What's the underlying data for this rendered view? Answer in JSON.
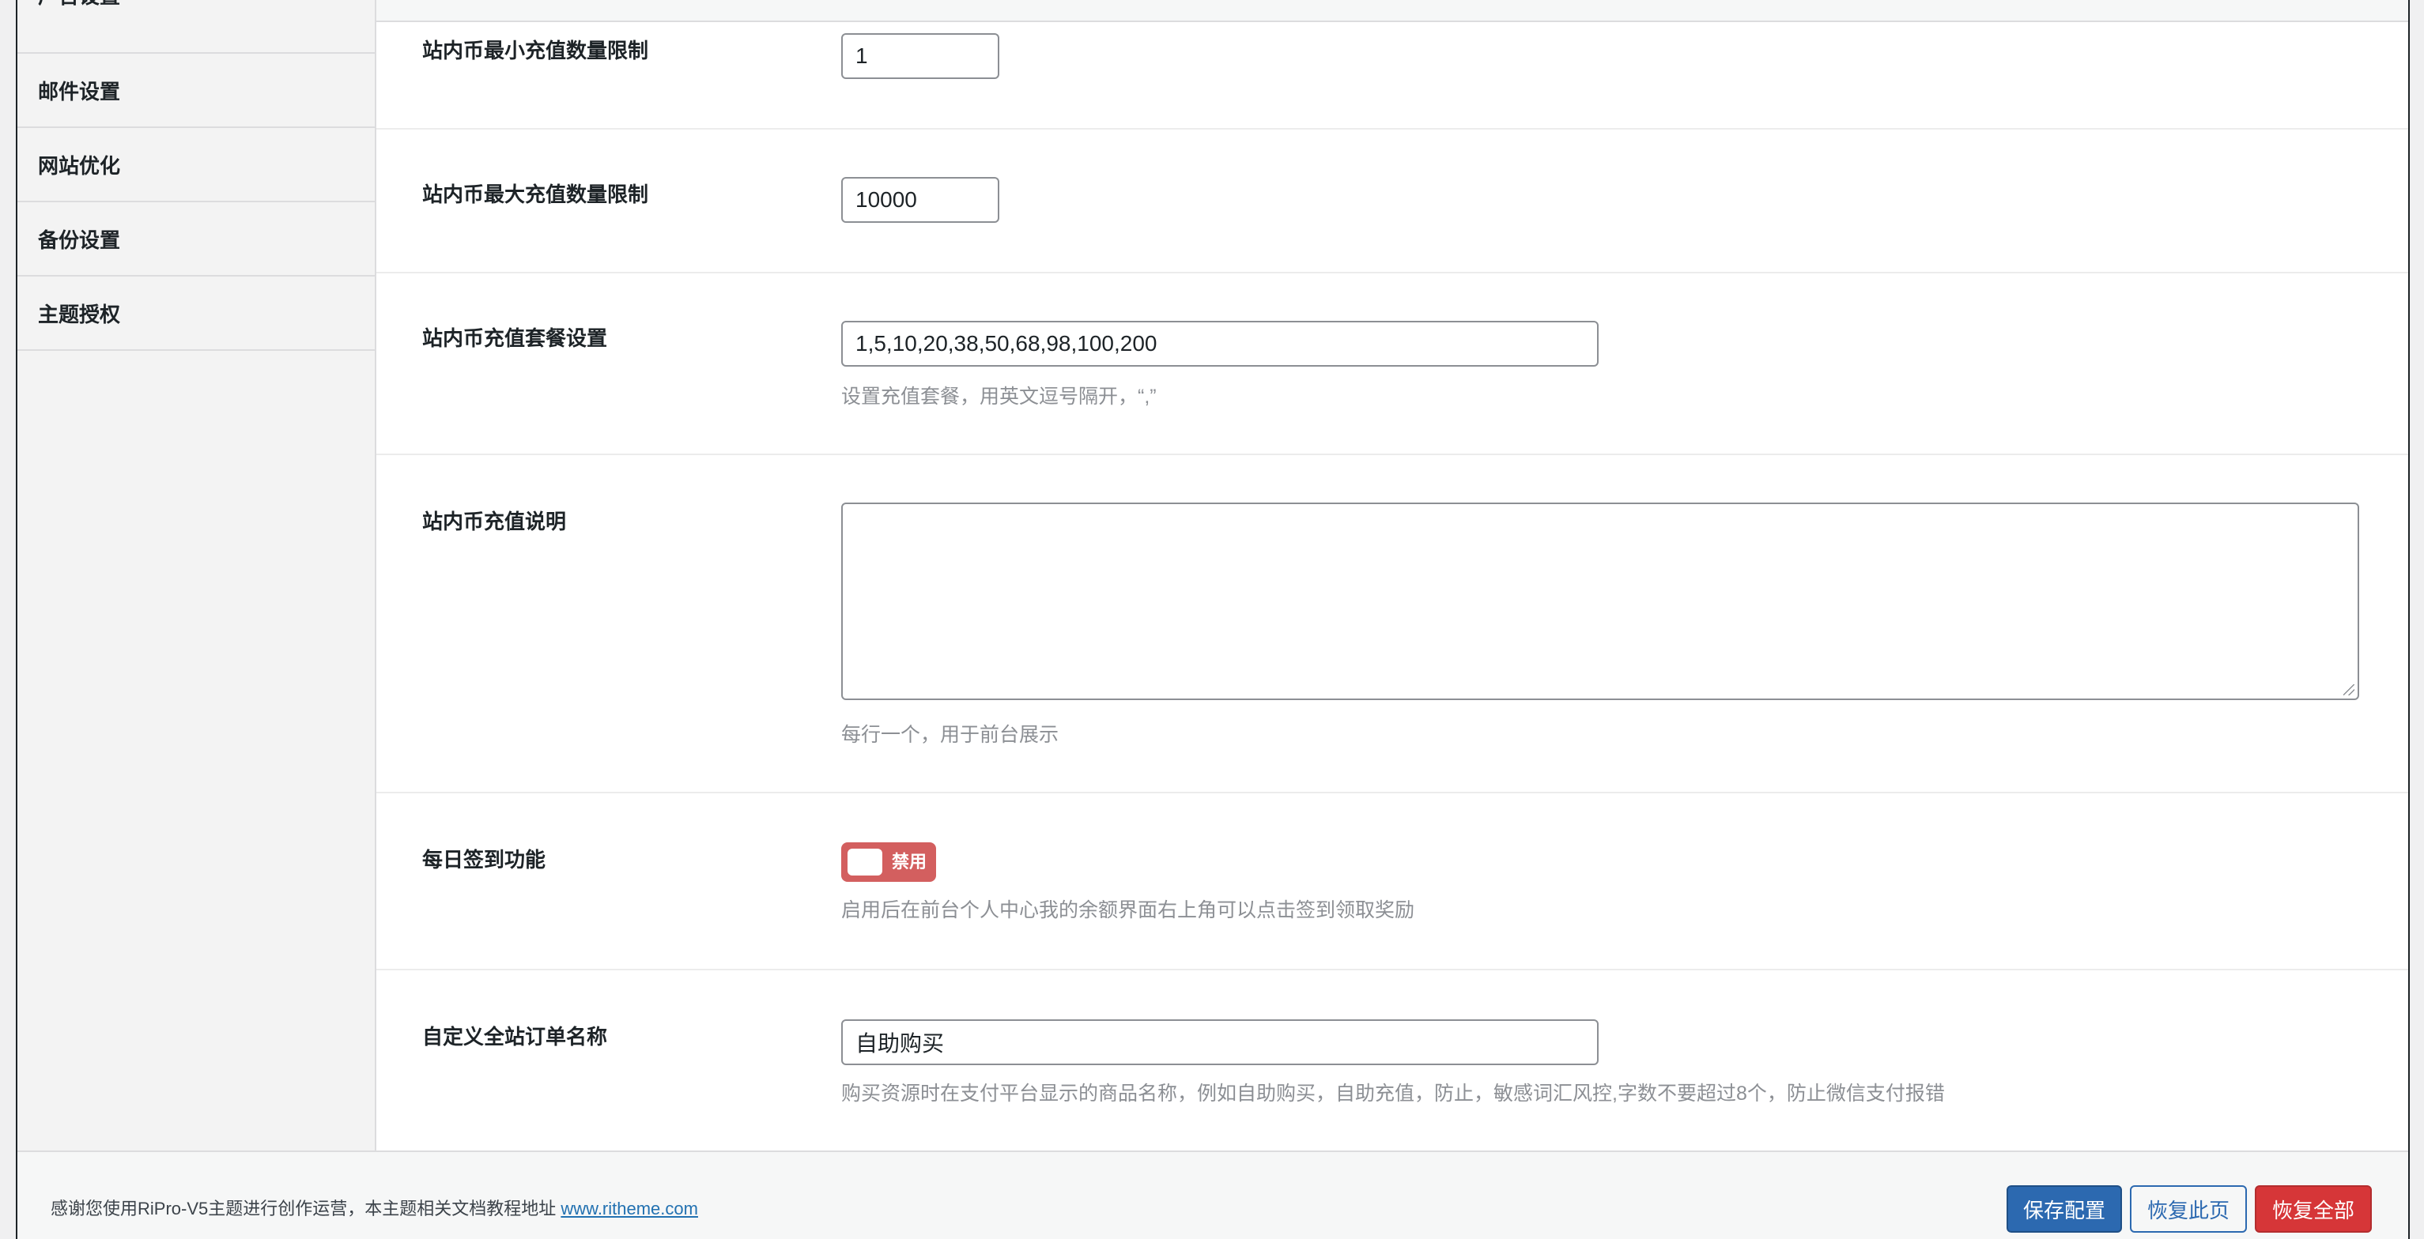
{
  "sidebar": {
    "items": [
      {
        "label": "广告设置"
      },
      {
        "label": "邮件设置"
      },
      {
        "label": "网站优化"
      },
      {
        "label": "备份设置"
      },
      {
        "label": "主题授权"
      }
    ]
  },
  "fields": {
    "min_recharge": {
      "label": "站内币最小充值数量限制",
      "value": "1"
    },
    "max_recharge": {
      "label": "站内币最大充值数量限制",
      "value": "10000"
    },
    "packages": {
      "label": "站内币充值套餐设置",
      "value": "1,5,10,20,38,50,68,98,100,200",
      "help": "设置充值套餐，用英文逗号隔开，“,”"
    },
    "description": {
      "label": "站内币充值说明",
      "value": "",
      "help": "每行一个，用于前台展示"
    },
    "daily_checkin": {
      "label": "每日签到功能",
      "toggle_text": "禁用",
      "enabled": false,
      "help": "启用后在前台个人中心我的余额界面右上角可以点击签到领取奖励"
    },
    "order_name": {
      "label": "自定义全站订单名称",
      "value": "自助购买",
      "help": "购买资源时在支付平台显示的商品名称，例如自助购买，自助充值，防止，敏感词汇风控,字数不要超过8个，防止微信支付报错"
    }
  },
  "footer": {
    "text": "感谢您使用RiPro-V5主题进行创作运营，本主题相关文档教程地址",
    "link_text": "www.ritheme.com",
    "buttons": {
      "save": "保存配置",
      "reset_page": "恢复此页",
      "reset_all": "恢复全部"
    }
  },
  "colors": {
    "primary": "#2c69b0",
    "danger": "#d63638",
    "toggle_off": "#d35f5f"
  }
}
